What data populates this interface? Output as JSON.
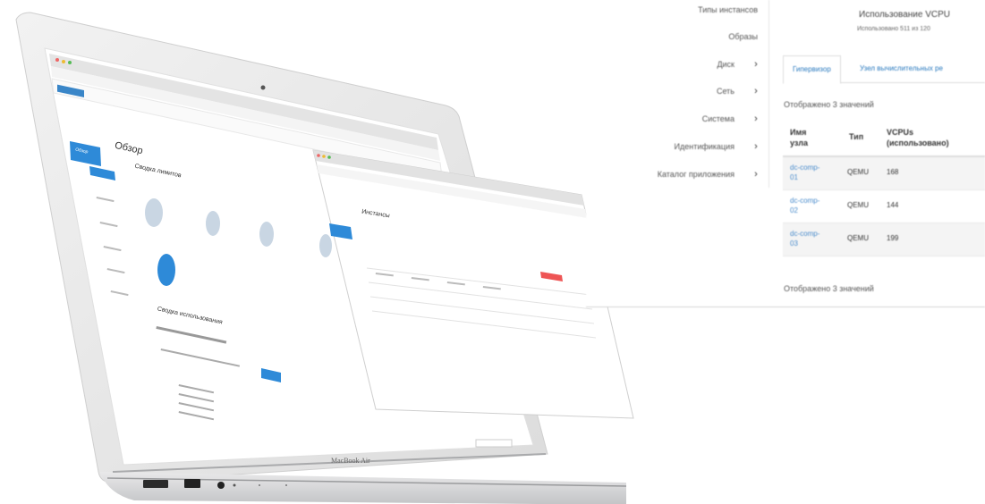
{
  "laptop": {
    "brand": "MacBook Air",
    "back_window": {
      "nav_items": [
        "Обзор"
      ],
      "page_title": "Обзор",
      "section_limits": "Сводка лимитов",
      "section_usage": "Сводка использования"
    },
    "front_window": {
      "page_title": "Инстансы"
    }
  },
  "zoom": {
    "menu": [
      {
        "label": "Типы инстансов",
        "chevron": false
      },
      {
        "label": "Образы",
        "chevron": false
      },
      {
        "label": "Диск",
        "chevron": true
      },
      {
        "label": "Сеть",
        "chevron": true
      },
      {
        "label": "Система",
        "chevron": true
      },
      {
        "label": "Идентификация",
        "chevron": true
      },
      {
        "label": "Каталог приложения",
        "chevron": true
      }
    ],
    "usage_title": "Использование VCPU",
    "usage_sub": "Использовано 511 из 120",
    "tabs": [
      "Гипервизор",
      "Узел вычислительных ре"
    ],
    "shown_top": "Отображено 3 значений",
    "shown_bottom": "Отображено 3 значений",
    "columns": [
      "Имя узла",
      "Тип",
      "VCPUs (использовано)"
    ],
    "rows": [
      {
        "name": "dc-comp-01",
        "type": "QEMU",
        "vcpus": "168"
      },
      {
        "name": "dc-comp-02",
        "type": "QEMU",
        "vcpus": "144"
      },
      {
        "name": "dc-comp-03",
        "type": "QEMU",
        "vcpus": "199"
      }
    ],
    "colors": {
      "link": "#4a8ccc",
      "accent": "#2a7abf"
    }
  }
}
